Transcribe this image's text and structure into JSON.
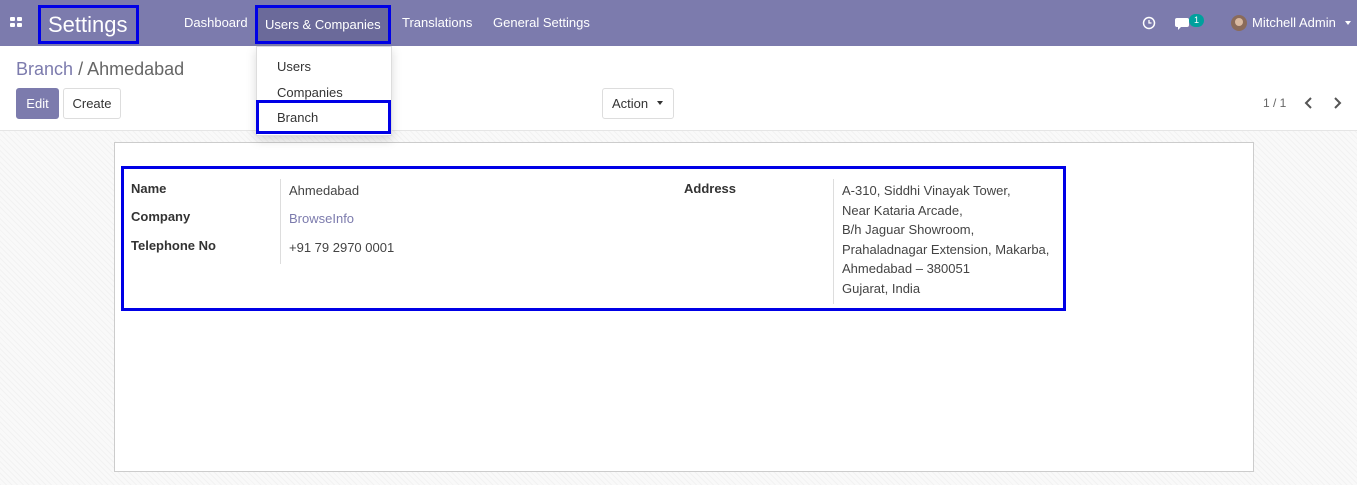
{
  "navbar": {
    "app_title": "Settings",
    "menus": [
      "Dashboard",
      "Users & Companies",
      "Translations",
      "General Settings"
    ],
    "message_count": "1",
    "user_name": "Mitchell Admin"
  },
  "dropdown": {
    "items": [
      "Users",
      "Companies",
      "Branch"
    ]
  },
  "breadcrumb": {
    "parent": "Branch",
    "separator": "/",
    "current": "Ahmedabad"
  },
  "buttons": {
    "edit": "Edit",
    "create": "Create",
    "action": "Action"
  },
  "pager": {
    "text": "1 / 1"
  },
  "form": {
    "name_label": "Name",
    "name_value": "Ahmedabad",
    "company_label": "Company",
    "company_value": "BrowseInfo",
    "telephone_label": "Telephone No",
    "telephone_value": "+91 79 2970 0001",
    "address_label": "Address",
    "address_lines": [
      "A-310, Siddhi Vinayak Tower,",
      "Near Kataria Arcade,",
      "B/h Jaguar Showroom,",
      "Prahaladnagar Extension, Makarba,",
      "Ahmedabad – 380051",
      "Gujarat, India"
    ]
  },
  "colors": {
    "brand": "#7c7bad",
    "highlight": "#0000e6",
    "badge": "#00a09d"
  }
}
